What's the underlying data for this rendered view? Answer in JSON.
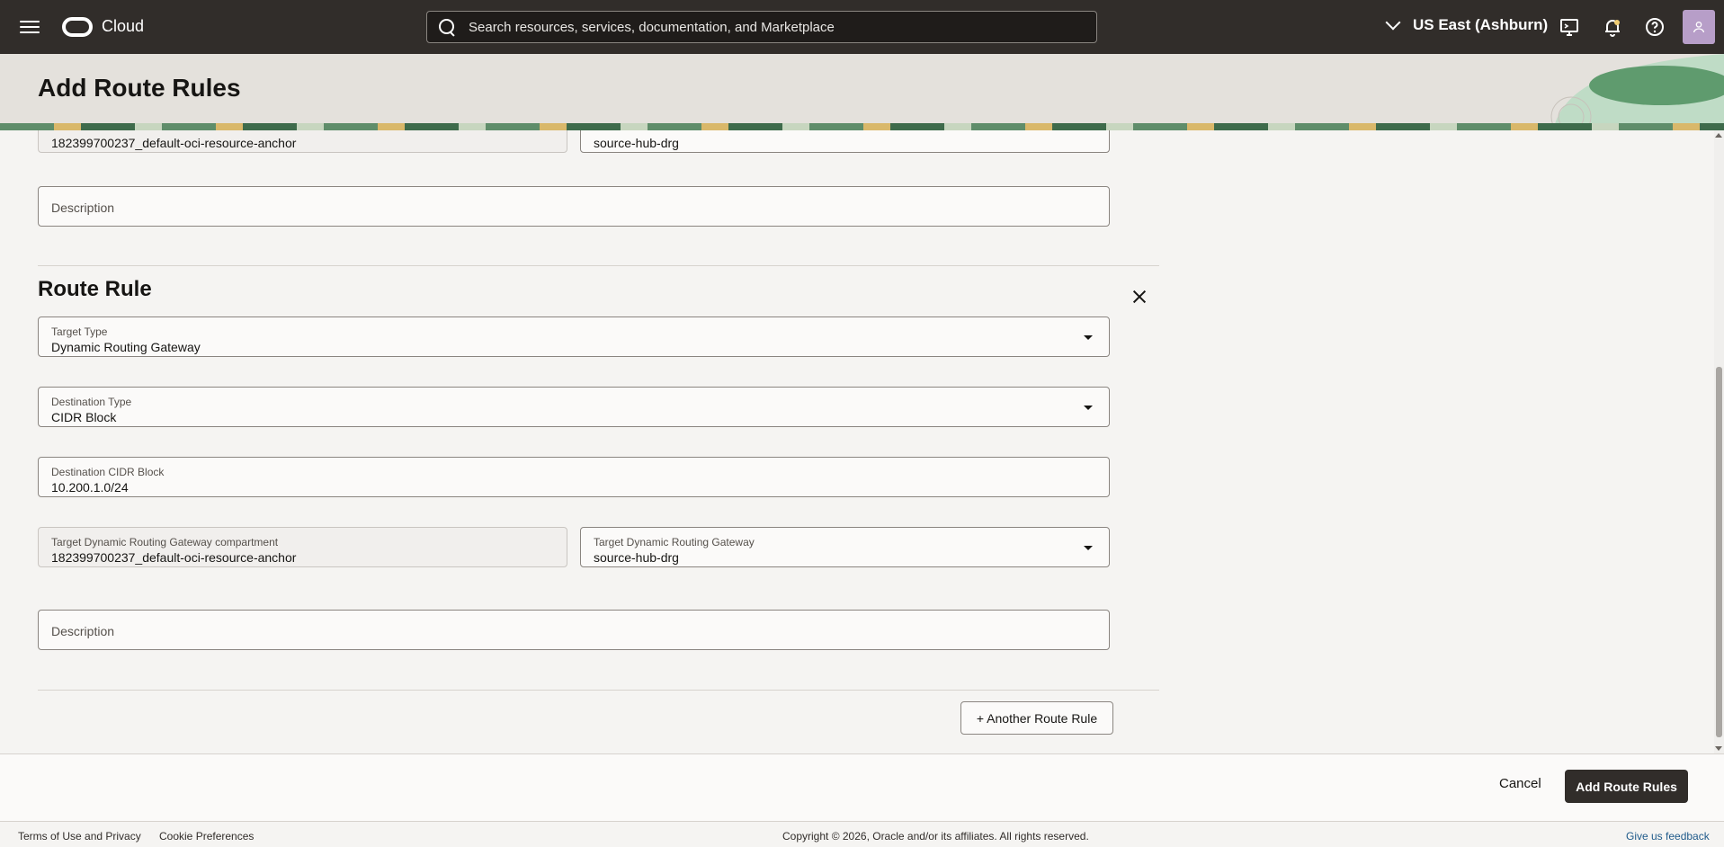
{
  "topbar": {
    "brand": "Cloud",
    "search_placeholder": "Search resources, services, documentation, and Marketplace",
    "region": "US East (Ashburn)"
  },
  "header": {
    "title": "Add Route Rules"
  },
  "prev_rule": {
    "compartment_value": "182399700237_default-oci-resource-anchor",
    "gateway_value": "source-hub-drg",
    "description_placeholder": "Description"
  },
  "route_rule": {
    "title": "Route Rule",
    "target_type_label": "Target Type",
    "target_type_value": "Dynamic Routing Gateway",
    "destination_type_label": "Destination Type",
    "destination_type_value": "CIDR Block",
    "cidr_label": "Destination CIDR Block",
    "cidr_value": "10.200.1.0/24",
    "compartment_label": "Target Dynamic Routing Gateway compartment",
    "compartment_value": "182399700237_default-oci-resource-anchor",
    "gateway_label": "Target Dynamic Routing Gateway",
    "gateway_value": "source-hub-drg",
    "description_placeholder": "Description"
  },
  "another_rule_label": "+ Another Route Rule",
  "actions": {
    "cancel": "Cancel",
    "submit": "Add Route Rules"
  },
  "footer": {
    "terms": "Terms of Use and Privacy",
    "cookies": "Cookie Preferences",
    "copyright": "Copyright © 2026, Oracle and/or its affiliates. All rights reserved.",
    "feedback": "Give us feedback"
  },
  "colors": {
    "topbar": "#312d2a",
    "primary_button": "#312d2a",
    "avatar": "#b79ec8",
    "feedback_link": "#1f5a8a"
  },
  "icons": [
    "menu-icon",
    "oracle-logo-icon",
    "search-icon",
    "chevron-down-icon",
    "cloud-shell-icon",
    "bell-icon",
    "help-icon",
    "user-icon",
    "close-icon",
    "caret-down-icon"
  ]
}
